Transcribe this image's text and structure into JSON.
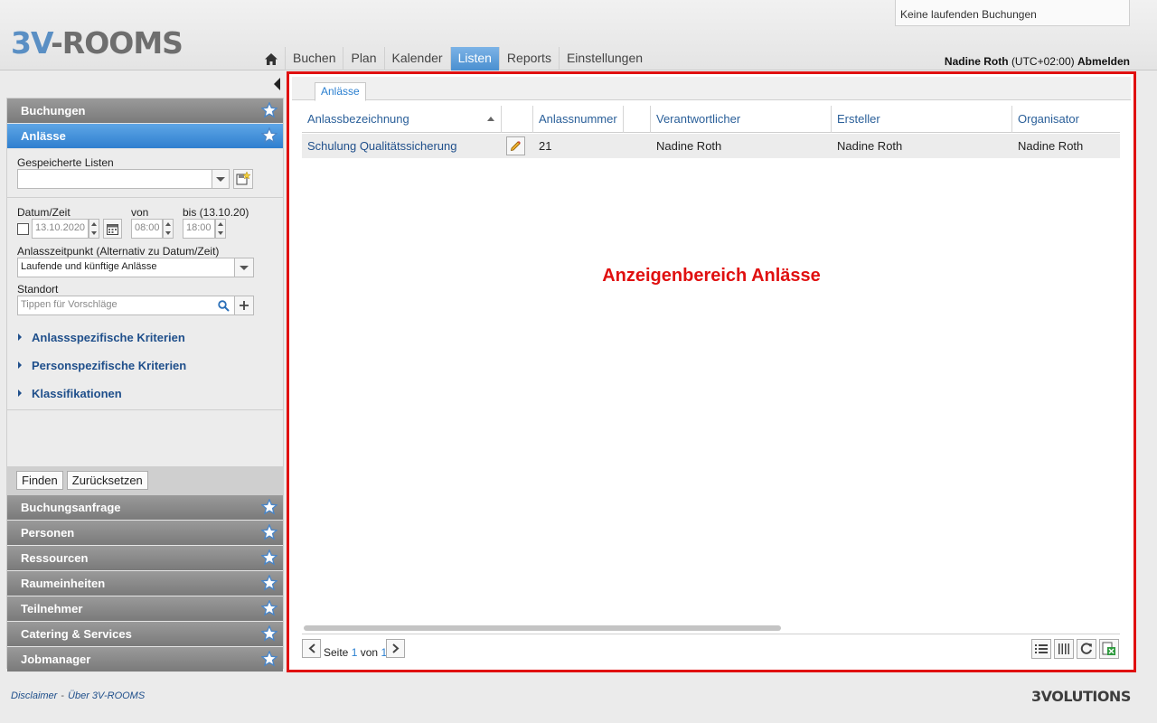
{
  "app": {
    "logo_prefix": "3V",
    "logo_suffix": "-ROOMS"
  },
  "status": {
    "text": "Keine laufenden Buchungen"
  },
  "nav": {
    "home_icon": "home-icon",
    "items": [
      "Buchen",
      "Plan",
      "Kalender",
      "Listen",
      "Reports",
      "Einstellungen"
    ],
    "active": "Listen"
  },
  "user": {
    "name": "Nadine Roth",
    "timezone": "(UTC+02:00)",
    "logout": "Abmelden"
  },
  "sidebar": {
    "top_sections": [
      "Buchungen",
      "Anlässe"
    ],
    "active_section": "Anlässe",
    "saved_lists_label": "Gespeicherte Listen",
    "saved_lists_value": "",
    "date_label": "Datum/Zeit",
    "from_label": "von",
    "to_label": "bis (13.10.20)",
    "date_value": "13.10.2020",
    "from_value": "08:00",
    "to_value": "18:00",
    "event_time_label": "Anlasszeitpunkt (Alternativ zu Datum/Zeit)",
    "event_time_value": "Laufende und künftige Anlässe",
    "location_label": "Standort",
    "location_placeholder": "Tippen für Vorschläge",
    "criteria": [
      "Anlassspezifische Kriterien",
      "Personspezifische Kriterien",
      "Klassifikationen"
    ],
    "find_button": "Finden",
    "reset_button": "Zurücksetzen",
    "bottom_sections": [
      "Buchungsanfrage",
      "Personen",
      "Ressourcen",
      "Raumeinheiten",
      "Teilnehmer",
      "Catering & Services",
      "Jobmanager"
    ]
  },
  "main": {
    "tab": "Anlässe",
    "columns": [
      "Anlassbezeichnung",
      "",
      "Anlassnummer",
      "",
      "Verantwortlicher",
      "Ersteller",
      "Organisator"
    ],
    "rows": [
      {
        "name": "Schulung Qualitätssicherung",
        "number": "21",
        "responsible": "Nadine Roth",
        "creator": "Nadine Roth",
        "organizer": "Nadine Roth"
      }
    ],
    "annotation": "Anzeigenbereich Anlässe",
    "pager": {
      "page_label": "Seite",
      "page": "1",
      "of_label": "von",
      "total": "1"
    }
  },
  "footer": {
    "disclaimer": "Disclaimer",
    "separator": "-",
    "about": "Über 3V-ROOMS",
    "brand_prefix": "3V",
    "brand_suffix": "OLUTIONS"
  },
  "colors": {
    "accent": "#4a8fd0",
    "annotation": "#e01010",
    "link": "#1f4f8b"
  }
}
